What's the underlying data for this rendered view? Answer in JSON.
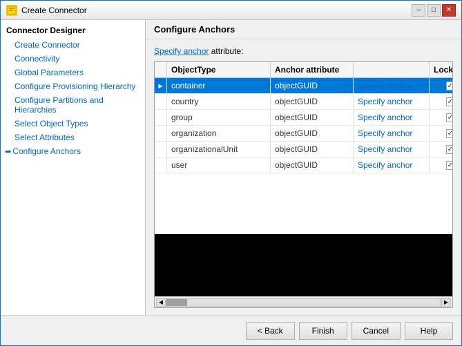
{
  "window": {
    "title": "Create Connector",
    "icon": "gear-icon"
  },
  "titlebar": {
    "minimize_label": "–",
    "maximize_label": "□",
    "close_label": "✕"
  },
  "sidebar": {
    "header": "Connector Designer",
    "items": [
      {
        "label": "Create Connector",
        "active": false,
        "arrow": false
      },
      {
        "label": "Connectivity",
        "active": false,
        "arrow": false
      },
      {
        "label": "Global Parameters",
        "active": false,
        "arrow": false
      },
      {
        "label": "Configure Provisioning Hierarchy",
        "active": false,
        "arrow": false
      },
      {
        "label": "Configure Partitions and Hierarchies",
        "active": false,
        "arrow": false
      },
      {
        "label": "Select Object Types",
        "active": false,
        "arrow": false
      },
      {
        "label": "Select Attributes",
        "active": false,
        "arrow": false
      },
      {
        "label": "Configure Anchors",
        "active": true,
        "arrow": true
      }
    ]
  },
  "main": {
    "panel_header": "Configure Anchors",
    "anchor_label_prefix": "Specify anchor",
    "anchor_label_suffix": " attribute:",
    "table": {
      "columns": [
        {
          "label": "",
          "key": "arrow"
        },
        {
          "label": "ObjectType",
          "key": "objectType"
        },
        {
          "label": "Anchor attribute",
          "key": "anchorAttribute"
        },
        {
          "label": "",
          "key": "specifyAnchor"
        },
        {
          "label": "Locked",
          "key": "locked"
        }
      ],
      "rows": [
        {
          "selected": true,
          "arrow": "▶",
          "objectType": "container",
          "anchorAttribute": "objectGUID",
          "specifyAnchor": "Specify anchor",
          "locked": true
        },
        {
          "selected": false,
          "arrow": "",
          "objectType": "country",
          "anchorAttribute": "objectGUID",
          "specifyAnchor": "Specify anchor",
          "locked": true
        },
        {
          "selected": false,
          "arrow": "",
          "objectType": "group",
          "anchorAttribute": "objectGUID",
          "specifyAnchor": "Specify anchor",
          "locked": true
        },
        {
          "selected": false,
          "arrow": "",
          "objectType": "organization",
          "anchorAttribute": "objectGUID",
          "specifyAnchor": "Specify anchor",
          "locked": true
        },
        {
          "selected": false,
          "arrow": "",
          "objectType": "organizationalUnit",
          "anchorAttribute": "objectGUID",
          "specifyAnchor": "Specify anchor",
          "locked": true
        },
        {
          "selected": false,
          "arrow": "",
          "objectType": "user",
          "anchorAttribute": "objectGUID",
          "specifyAnchor": "Specify anchor",
          "locked": true
        }
      ]
    }
  },
  "buttons": {
    "back": "< Back",
    "finish": "Finish",
    "cancel": "Cancel",
    "help": "Help"
  }
}
